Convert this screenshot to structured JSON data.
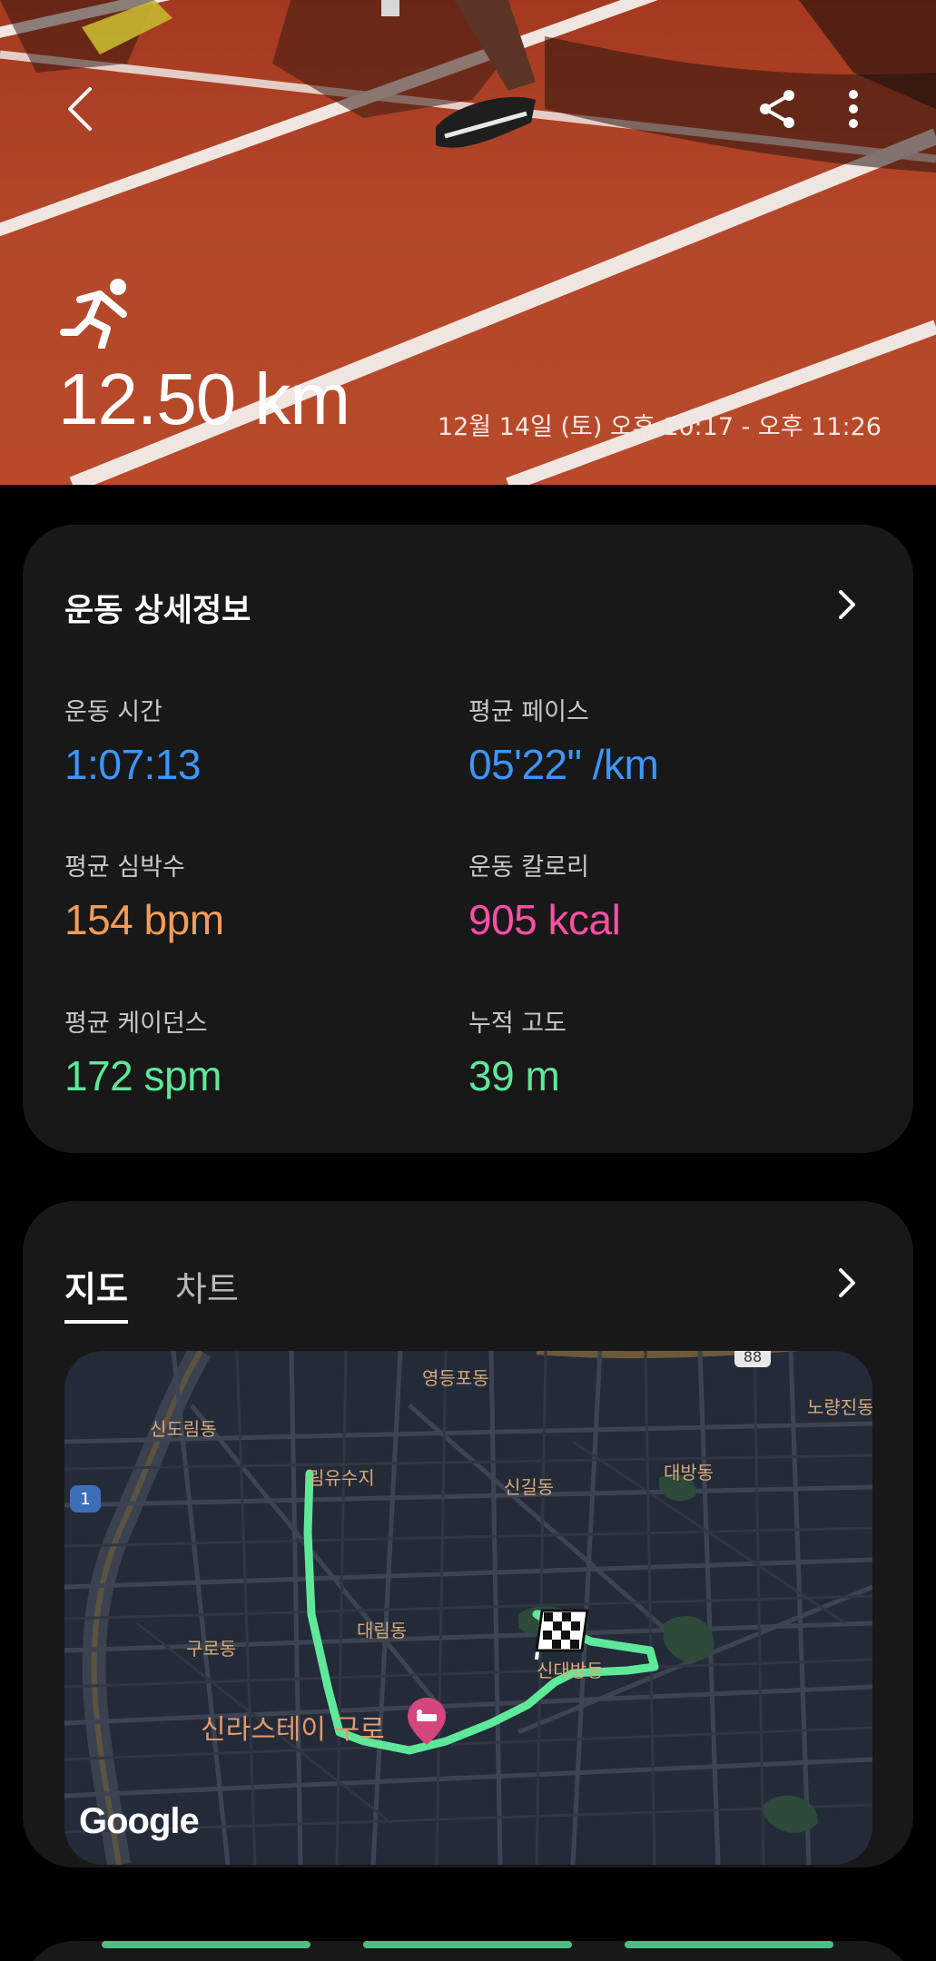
{
  "header": {
    "distance": "12.50 km",
    "datetime": "12월 14일 (토) 오후 10:17 - 오후 11:26"
  },
  "details": {
    "title": "운동 상세정보",
    "stats": [
      {
        "label": "운동 시간",
        "value": "1:07:13"
      },
      {
        "label": "평균 페이스",
        "value": "05'22\" /km"
      },
      {
        "label": "평균 심박수",
        "value": "154 bpm"
      },
      {
        "label": "운동 칼로리",
        "value": "905 kcal"
      },
      {
        "label": "평균 케이던스",
        "value": "172 spm"
      },
      {
        "label": "누적 고도",
        "value": "39 m"
      }
    ]
  },
  "map_section": {
    "tabs": [
      {
        "label": "지도"
      },
      {
        "label": "차트"
      }
    ],
    "labels": {
      "yeongdeungpo_dong": "영등포동",
      "sindorim_dong": "신도림동",
      "yurim": "림유수지",
      "singil_dong": "신길동",
      "daebang_dong": "대방동",
      "noryangjin_dong": "노량진동",
      "guro_dong": "구로동",
      "daerim_dong": "대림동",
      "sindaebang_dong": "신대방동",
      "hotel": "신라스테이 구로"
    },
    "road_badges": {
      "route1": "1",
      "route88": "88"
    },
    "attribution": "Google"
  },
  "colors": {
    "blue": "#3e95ff",
    "orange": "#f19c5b",
    "pink": "#ff4fa6",
    "green": "#5ee89a",
    "route": "#5ee89a",
    "card_bg": "#181818"
  },
  "icons": [
    "back-icon",
    "share-icon",
    "more-icon",
    "running-icon",
    "chevron-right-icon",
    "finish-flag-icon",
    "hotel-pin-icon"
  ]
}
